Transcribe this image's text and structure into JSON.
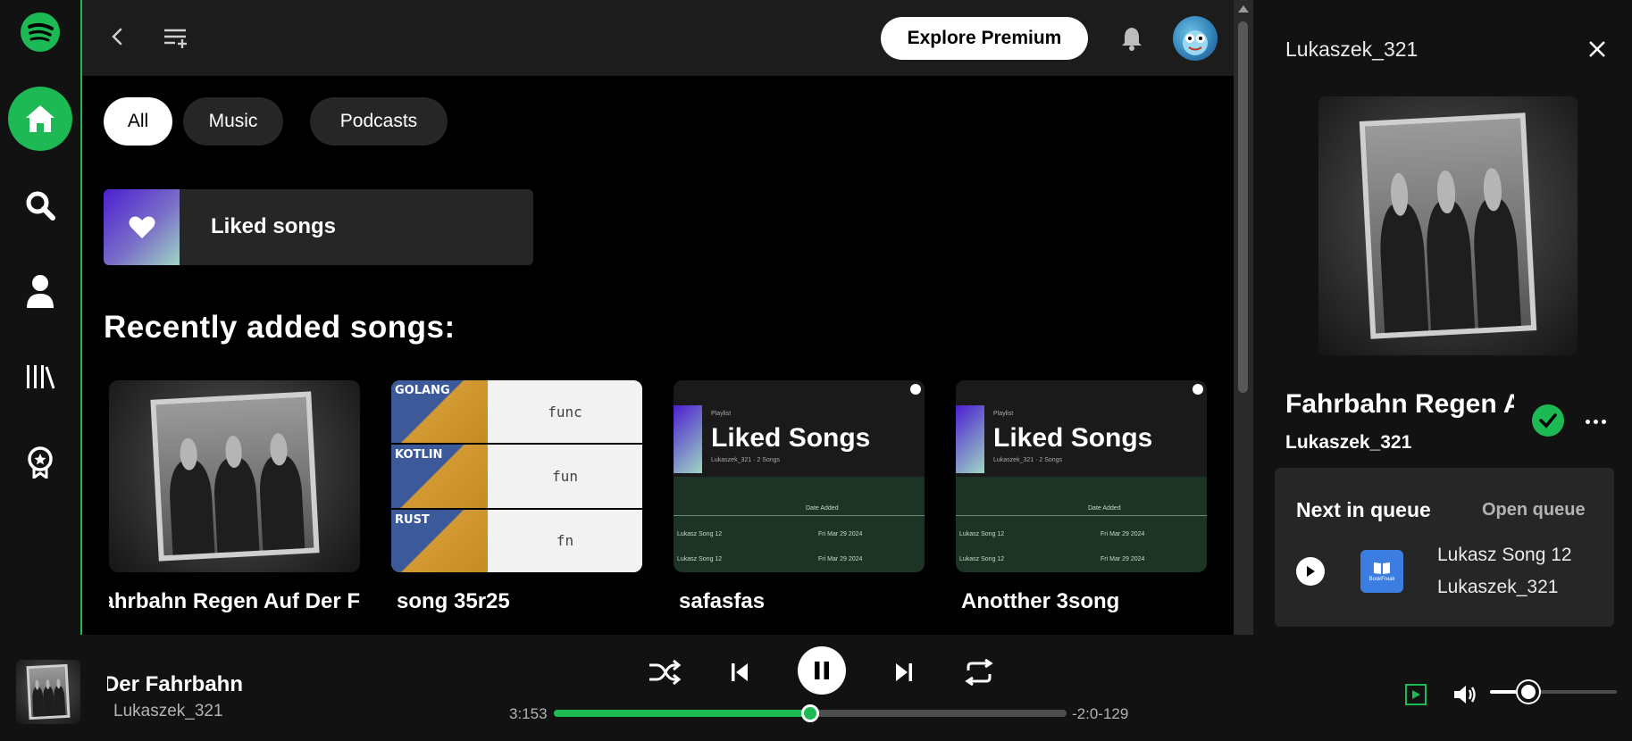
{
  "colors": {
    "accent": "#1db954",
    "panel": "#121212",
    "card": "#262626"
  },
  "nav": {
    "items": [
      {
        "name": "home",
        "icon": "home-icon",
        "active": true
      },
      {
        "name": "search",
        "icon": "search-icon"
      },
      {
        "name": "profile",
        "icon": "user-icon"
      },
      {
        "name": "library",
        "icon": "library-icon"
      },
      {
        "name": "badges",
        "icon": "badge-icon"
      }
    ]
  },
  "topbar": {
    "premium_label": "Explore Premium"
  },
  "filters": [
    "All",
    "Music",
    "Podcasts"
  ],
  "liked": {
    "label": "Liked songs"
  },
  "recent": {
    "heading": "Recently added songs:",
    "songs": [
      {
        "title": "Fahrbahn  Regen Auf Der F"
      },
      {
        "title": "song 35r25"
      },
      {
        "title": "safasfas"
      },
      {
        "title": "Anotther 3song"
      }
    ]
  },
  "meme": {
    "labels": [
      "GOLANG",
      "KOTLIN",
      "RUST"
    ],
    "code": [
      "func",
      "fun",
      "fn"
    ]
  },
  "liked_art": {
    "small": "Playlist",
    "title": "Liked Songs",
    "sub": "Lukaszek_321 · 2 Songs",
    "col": "Date Added",
    "rows": [
      {
        "song": "Lukasz Song 12",
        "date": "Fri Mar 29 2024"
      },
      {
        "song": "Lukasz Song 12",
        "date": "Fri Mar 29 2024"
      }
    ]
  },
  "rpanel": {
    "user": "Lukaszek_321",
    "title": "Fahrbahn  Regen Auf Der Fahrbahn",
    "artist": "Lukaszek_321",
    "queue": {
      "title": "Next in queue",
      "open_label": "Open queue",
      "song": "Lukasz Song 12",
      "artist": "Lukaszek_321",
      "thumb_label": "BookFreak"
    }
  },
  "player": {
    "title": "Fahrbahn  Regen Auf Der Fahrbahn",
    "artist": "Lukaszek_321",
    "elapsed": "3:153",
    "remaining": "-2:0-129",
    "progress": 0.5,
    "volume": 0.3
  }
}
